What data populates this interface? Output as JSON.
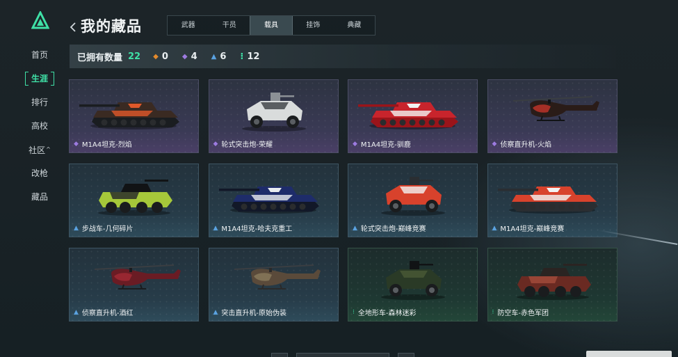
{
  "nav": {
    "items": [
      {
        "label": "首页",
        "active": false
      },
      {
        "label": "生涯",
        "active": true
      },
      {
        "label": "排行",
        "active": false
      },
      {
        "label": "高校",
        "active": false
      },
      {
        "label": "社区",
        "active": false,
        "caret": "^"
      },
      {
        "label": "改枪",
        "active": false
      },
      {
        "label": "藏品",
        "active": false
      }
    ]
  },
  "header": {
    "back_glyph": "‹",
    "title": "我的藏品"
  },
  "tabs": [
    {
      "label": "武器",
      "active": false
    },
    {
      "label": "干员",
      "active": false
    },
    {
      "label": "载具",
      "active": true
    },
    {
      "label": "挂饰",
      "active": false
    },
    {
      "label": "典藏",
      "active": false
    }
  ],
  "stats": {
    "owned_label": "已拥有数量",
    "owned_count": "22",
    "rarities": [
      {
        "icon": "orange-diamond-icon",
        "glyph": "◆",
        "color": "#e38a2c",
        "value": "0"
      },
      {
        "icon": "purple-diamond-icon",
        "glyph": "◆",
        "color": "#9d7be0",
        "value": "4"
      },
      {
        "icon": "blue-chevron-icon",
        "glyph": "▲",
        "color": "#5aa2e0",
        "value": "6"
      },
      {
        "icon": "green-dots-icon",
        "glyph": "⁝",
        "color": "#3fe0a6",
        "value": "12"
      }
    ]
  },
  "colors": {
    "accent": "#3fe0a6",
    "rarity_purple": "#9d7be0",
    "rarity_blue": "#5aa2e0",
    "rarity_green": "#3fe0a6"
  },
  "cards": [
    {
      "name": "M1A4坦克-烈焰",
      "rarity": "purple",
      "vehicle": "tank",
      "paint": "flame"
    },
    {
      "name": "轮式突击炮-荣耀",
      "rarity": "purple",
      "vehicle": "buggy",
      "paint": "glory"
    },
    {
      "name": "M1A4坦克-驯鹿",
      "rarity": "purple",
      "vehicle": "tank",
      "paint": "reindeer"
    },
    {
      "name": "侦察直升机-火焰",
      "rarity": "purple",
      "vehicle": "heli",
      "paint": "heliflame"
    },
    {
      "name": "步战车-几何碎片",
      "rarity": "blue",
      "vehicle": "ifv",
      "paint": "geometric"
    },
    {
      "name": "M1A4坦克-哈夫克重工",
      "rarity": "blue",
      "vehicle": "tank",
      "paint": "haavk"
    },
    {
      "name": "轮式突击炮-巅峰竞赛",
      "rarity": "blue",
      "vehicle": "buggy",
      "paint": "race"
    },
    {
      "name": "M1A4坦克-巅峰竞赛",
      "rarity": "blue",
      "vehicle": "tank",
      "paint": "race"
    },
    {
      "name": "侦察直升机-酒红",
      "rarity": "blue",
      "vehicle": "heli",
      "paint": "wine"
    },
    {
      "name": "突击直升机-原始伪装",
      "rarity": "blue",
      "vehicle": "attackheli",
      "paint": "camo"
    },
    {
      "name": "全地形车-森林迷彩",
      "rarity": "green",
      "vehicle": "atv",
      "paint": "forest"
    },
    {
      "name": "防空车-赤色军团",
      "rarity": "green",
      "vehicle": "aa",
      "paint": "redlegion"
    }
  ]
}
